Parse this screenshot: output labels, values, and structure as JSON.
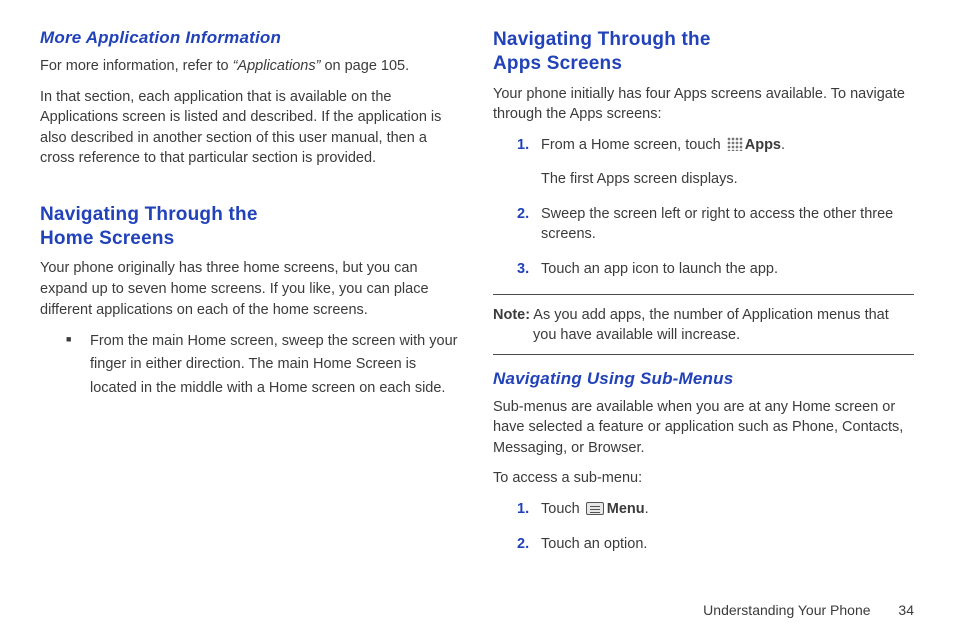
{
  "left": {
    "more_app_heading": "More Application Information",
    "more_app_p1_pre": "For more information, refer to ",
    "more_app_p1_ref": "“Applications”",
    "more_app_p1_post": " on page 105.",
    "more_app_p2": "In that section, each application that is available on the Applications screen is listed and described. If the application is also described in another section of this user manual, then a cross reference to that particular section is provided.",
    "nav_home_heading_l1": "Navigating Through the",
    "nav_home_heading_l2": "Home Screens",
    "nav_home_p1": "Your phone originally has three home screens, but you can expand up to seven home screens. If you like, you can place different applications on each of the home screens.",
    "nav_home_bullet": "From the main Home screen, sweep the screen with your finger in either direction. The main Home Screen is located in the middle with a Home screen on each side."
  },
  "right": {
    "nav_apps_heading_l1": "Navigating Through the",
    "nav_apps_heading_l2": "Apps Screens",
    "nav_apps_p1": "Your phone initially has four Apps screens available. To navigate through the Apps screens:",
    "step1_num": "1.",
    "step1_pre": "From a Home screen, touch ",
    "step1_apps_label": "Apps",
    "step1_post": ".",
    "step1_extra": "The first Apps screen displays.",
    "step2_num": "2.",
    "step2_text": "Sweep the screen left or right to access the other three screens.",
    "step3_num": "3.",
    "step3_text": "Touch an app icon to launch the app.",
    "note_label": "Note:",
    "note_text": " As you add apps, the number of Application menus that you have available will increase.",
    "submenu_heading": "Navigating Using Sub-Menus",
    "submenu_p1": "Sub-menus are available when you are at any Home screen or have selected a feature or application such as Phone, Contacts, Messaging, or Browser.",
    "submenu_p2": "To access a sub-menu:",
    "sub_step1_num": "1.",
    "sub_step1_pre": "Touch ",
    "sub_step1_menu_label": "Menu",
    "sub_step1_post": ".",
    "sub_step2_num": "2.",
    "sub_step2_text": "Touch an option."
  },
  "footer": {
    "section": "Understanding Your Phone",
    "page": "34"
  }
}
